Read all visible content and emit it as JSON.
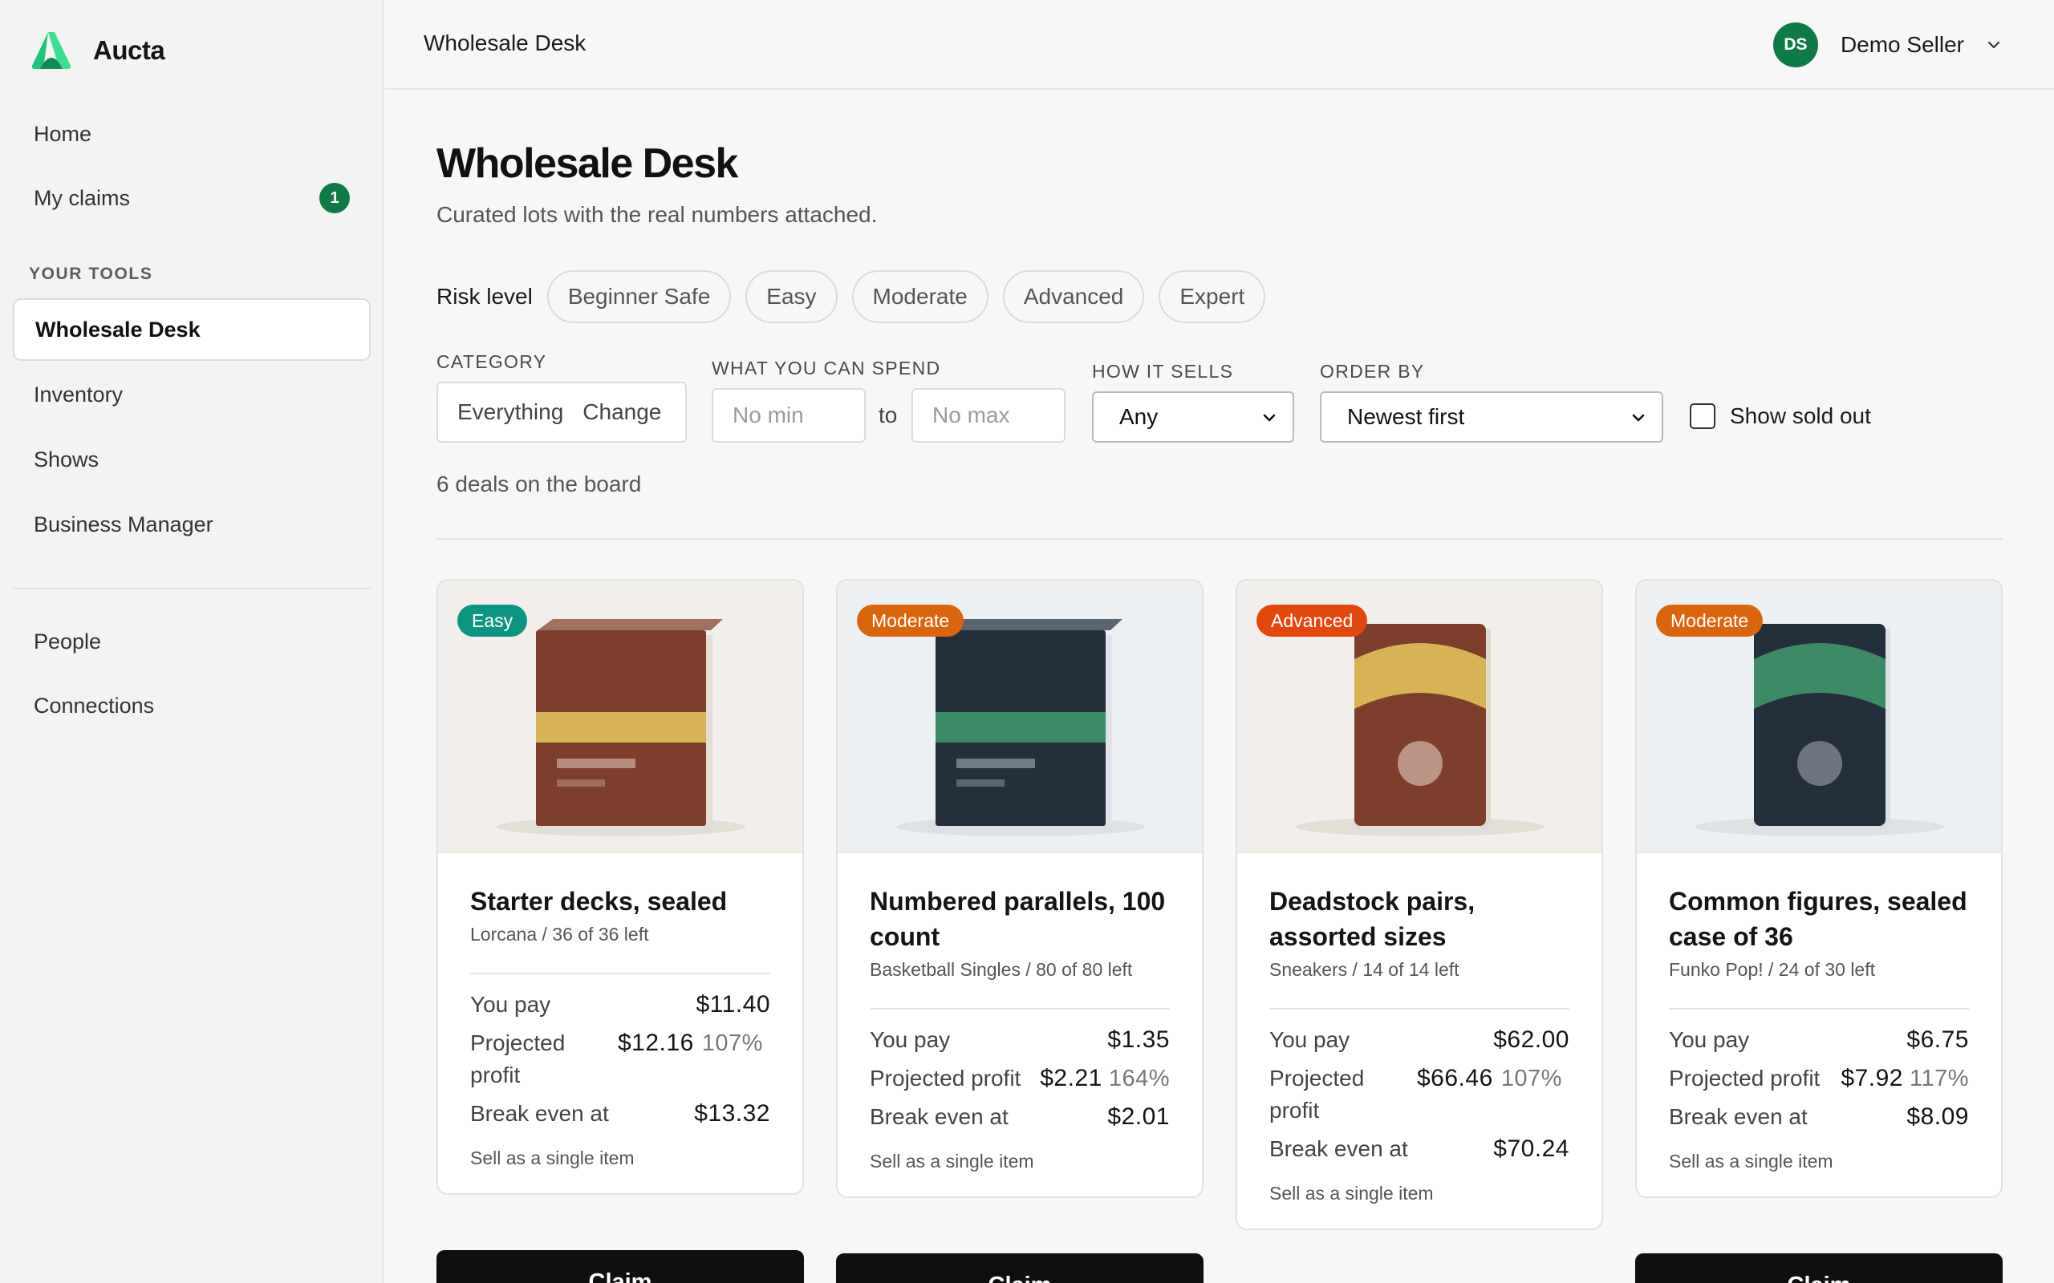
{
  "brand": {
    "name": "Aucta",
    "color": "#21c47a"
  },
  "sidebar": {
    "nav": [
      {
        "label": "Home"
      },
      {
        "label": "My claims",
        "badge": "1"
      }
    ],
    "section_label": "YOUR TOOLS",
    "tools": [
      {
        "label": "Wholesale Desk",
        "active": true
      },
      {
        "label": "Inventory"
      },
      {
        "label": "Shows"
      },
      {
        "label": "Business Manager"
      }
    ],
    "bottom": [
      {
        "label": "People"
      },
      {
        "label": "Connections"
      }
    ]
  },
  "topbar": {
    "title": "Wholesale Desk",
    "user": {
      "initials": "DS",
      "name": "Demo Seller",
      "menu_icon": "chevron-down-icon"
    }
  },
  "page": {
    "title": "Wholesale Desk",
    "subtitle": "Curated lots with the real numbers attached."
  },
  "filters": {
    "risk_label": "Risk level",
    "risk_options": [
      "Beginner Safe",
      "Easy",
      "Moderate",
      "Advanced",
      "Expert"
    ],
    "category_label": "CATEGORY",
    "category_value": "Everything",
    "category_change": "Change",
    "spend_label": "WHAT YOU CAN SPEND",
    "min_placeholder": "No min",
    "to_label": "to",
    "max_placeholder": "No max",
    "sells_label": "HOW IT SELLS",
    "sells_value": "Any",
    "order_label": "ORDER BY",
    "order_value": "Newest first",
    "sold_out_label": "Show sold out",
    "sold_out_checked": false
  },
  "deal_count": "6 deals on the board",
  "labels": {
    "you_pay": "You pay",
    "projected_profit": "Projected profit",
    "break_even": "Break even at",
    "claim": "Claim"
  },
  "colors": {
    "easy": "#0e9582",
    "moderate": "#d9650f",
    "advanced": "#e0480f",
    "brand_green": "#0f7a47"
  },
  "deals": [
    {
      "risk": "Easy",
      "title": "Starter decks, sealed",
      "meta": "Lorcana / 36 of 36 left",
      "you_pay": "$11.40",
      "profit": "$12.16",
      "profit_pct": "107%",
      "break_even": "$13.32",
      "sell_note": "Sell as a single item",
      "image": "box-brown-icon"
    },
    {
      "risk": "Moderate",
      "title": "Numbered parallels, 100 count",
      "meta": "Basketball Singles / 80 of 80 left",
      "you_pay": "$1.35",
      "profit": "$2.21",
      "profit_pct": "164%",
      "break_even": "$2.01",
      "sell_note": "Sell as a single item",
      "image": "box-navy-icon"
    },
    {
      "risk": "Advanced",
      "title": "Deadstock pairs, assorted sizes",
      "meta": "Sneakers / 14 of 14 left",
      "you_pay": "$62.00",
      "profit": "$66.46",
      "profit_pct": "107%",
      "break_even": "$70.24",
      "sell_note": "Sell as a single item",
      "image": "pack-brown-icon"
    },
    {
      "risk": "Moderate",
      "title": "Common figures, sealed case of 36",
      "meta": "Funko Pop! / 24 of 30 left",
      "you_pay": "$6.75",
      "profit": "$7.92",
      "profit_pct": "117%",
      "break_even": "$8.09",
      "sell_note": "Sell as a single item",
      "image": "pack-navy-icon"
    }
  ]
}
